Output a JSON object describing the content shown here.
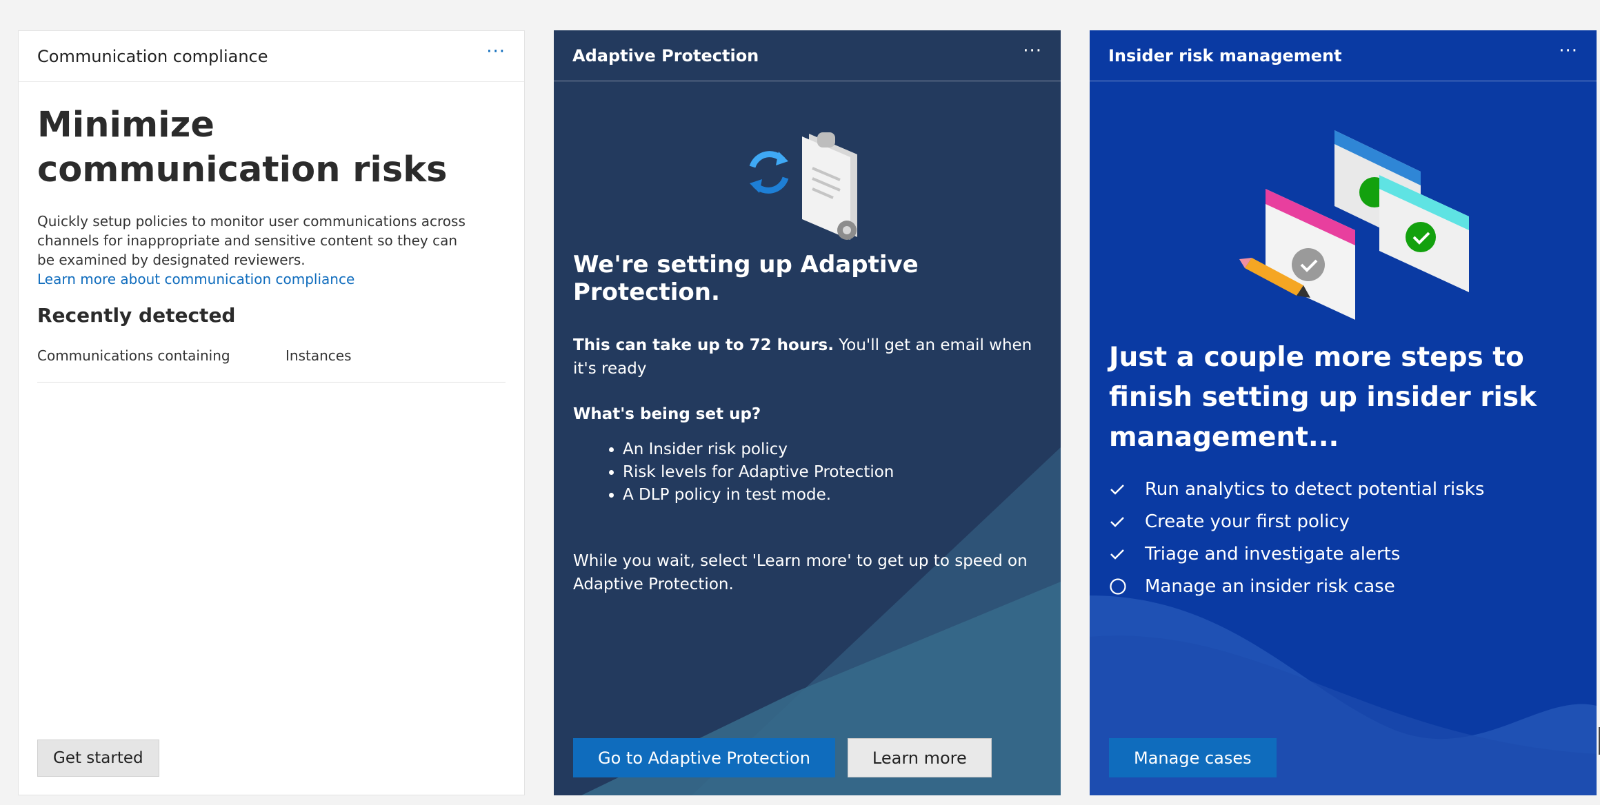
{
  "cards": {
    "communication_compliance": {
      "header_title": "Communication compliance",
      "more_label": "···",
      "title": "Minimize communication risks",
      "description": "Quickly setup policies to monitor user communications across channels for inappropriate and sensitive content so they can be examined by designated reviewers.",
      "learn_more_link": "Learn more about communication compliance",
      "section_title": "Recently detected",
      "table_headers": [
        "Communications containing",
        "Instances"
      ],
      "button_label": "Get started"
    },
    "adaptive_protection": {
      "header_title": "Adaptive Protection",
      "more_label": "···",
      "title": "We're setting up Adaptive Protection.",
      "time_bold": "This can take up to 72 hours.",
      "time_rest": " You'll get an email when it's ready",
      "question": "What's being set up?",
      "items": [
        "An Insider risk policy",
        "Risk levels for Adaptive Protection",
        "A DLP policy in test mode."
      ],
      "wait_text": "While you wait, select 'Learn more' to get up to speed on Adaptive Protection.",
      "primary_button": "Go to Adaptive Protection",
      "secondary_button": "Learn more"
    },
    "insider_risk": {
      "header_title": "Insider risk management",
      "more_label": "···",
      "title": "Just a couple more steps to finish setting up insider risk management...",
      "steps": [
        {
          "label": "Run analytics to detect potential risks",
          "icon": "check-icon"
        },
        {
          "label": "Create your first policy",
          "icon": "check-icon"
        },
        {
          "label": "Triage and investigate alerts",
          "icon": "check-icon"
        },
        {
          "label": "Manage an insider risk case",
          "icon": "circle-icon"
        }
      ],
      "button_label": "Manage cases"
    }
  },
  "colors": {
    "page_bg": "#f3f3f3",
    "adaptive_bg": "#233a5e",
    "insider_bg": "#0a3aa3",
    "primary": "#0f6cbd"
  }
}
